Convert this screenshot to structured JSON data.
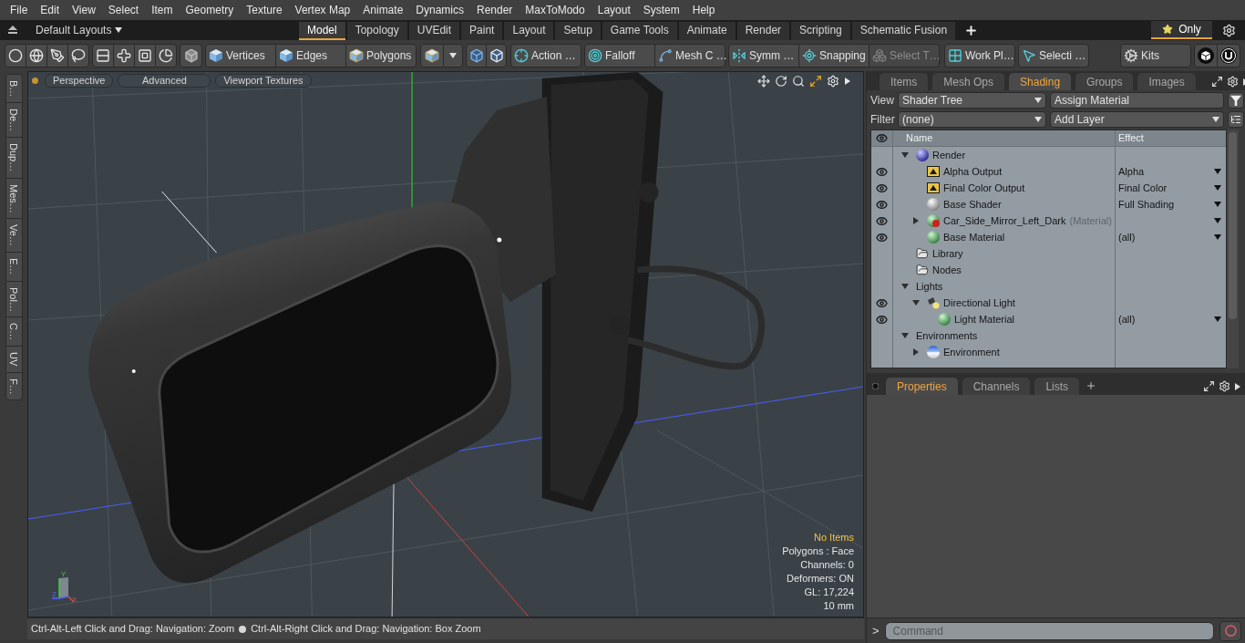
{
  "menu_bar": [
    "File",
    "Edit",
    "View",
    "Select",
    "Item",
    "Geometry",
    "Texture",
    "Vertex Map",
    "Animate",
    "Dynamics",
    "Render",
    "MaxToModo",
    "Layout",
    "System",
    "Help"
  ],
  "layout_bar": {
    "layouts": "Default Layouts",
    "tabs": [
      {
        "label": "Model",
        "selected": true
      },
      {
        "label": "Topology",
        "selected": false
      },
      {
        "label": "UVEdit",
        "selected": false
      },
      {
        "label": "Paint",
        "selected": false
      },
      {
        "label": "Layout",
        "selected": false
      },
      {
        "label": "Setup",
        "selected": false
      },
      {
        "label": "Game Tools",
        "selected": false
      },
      {
        "label": "Animate",
        "selected": false
      },
      {
        "label": "Render",
        "selected": false
      },
      {
        "label": "Scripting",
        "selected": false
      },
      {
        "label": "Schematic Fusion",
        "selected": false
      }
    ],
    "favorites": {
      "label": "Only",
      "selected": true
    }
  },
  "toolbar": {
    "buttons": [
      {
        "label": "Vertices",
        "disabled": false
      },
      {
        "label": "Edges",
        "disabled": false
      },
      {
        "label": "Polygons",
        "disabled": false
      },
      {
        "label": "Action …",
        "disabled": false
      },
      {
        "label": "Falloff",
        "disabled": false
      },
      {
        "label": "Mesh C …",
        "disabled": false
      },
      {
        "label": "Symm …",
        "disabled": false
      },
      {
        "label": "Snapping",
        "disabled": false
      },
      {
        "label": "Select T…",
        "disabled": true
      },
      {
        "label": "Work Pl…",
        "disabled": false
      },
      {
        "label": "Selecti …",
        "disabled": false
      },
      {
        "label": "Kits",
        "disabled": false
      }
    ]
  },
  "side_tabs": [
    "B…",
    "De…",
    "Dup…",
    "Mes…",
    "Ve…",
    "E…",
    "Pol…",
    "C…",
    "UV",
    "F…"
  ],
  "viewport": {
    "buttons": [
      "Perspective",
      "Advanced",
      "Viewport Textures"
    ],
    "axis_labels": [
      "Y",
      "Z",
      "X"
    ],
    "info": [
      {
        "kind": "title",
        "text": "No Items"
      },
      {
        "kind": "stat",
        "text": "Polygons : Face"
      },
      {
        "kind": "stat",
        "text": "Channels: 0"
      },
      {
        "kind": "stat",
        "text": "Deformers: ON"
      },
      {
        "kind": "stat",
        "text": "GL: 17,224"
      },
      {
        "kind": "stat",
        "text": "10 mm"
      }
    ]
  },
  "status_bar": {
    "hints": [
      "Ctrl-Alt-Left Click and Drag: Navigation: Zoom",
      "Ctrl-Alt-Right Click and Drag: Navigation: Box Zoom"
    ]
  },
  "shading_panel": {
    "tabs": [
      {
        "label": "Items",
        "selected": false
      },
      {
        "label": "Mesh Ops",
        "selected": false
      },
      {
        "label": "Shading",
        "selected": true
      },
      {
        "label": "Groups",
        "selected": false
      },
      {
        "label": "Images",
        "selected": false
      }
    ],
    "view": {
      "label": "View",
      "value": "Shader Tree"
    },
    "assign_button": "Assign Material",
    "filter": {
      "label": "Filter",
      "value": "(none)"
    },
    "add_layer": "Add Layer",
    "columns": [
      "Name",
      "Effect"
    ],
    "tree": [
      {
        "name": "Render",
        "kind": "render",
        "visible": false,
        "effect_menu": false,
        "expanded": true,
        "children": [
          {
            "name": "Alpha Output",
            "kind": "output",
            "visible": true,
            "effect_menu": true,
            "effect": "Alpha"
          },
          {
            "name": "Final Color Output",
            "kind": "output",
            "visible": true,
            "effect_menu": true,
            "effect": "Final Color"
          },
          {
            "name": "Base Shader",
            "kind": "shader",
            "visible": true,
            "effect_menu": true,
            "effect": "Full Shading"
          },
          {
            "name": "Car_Side_Mirror_Left_Dark",
            "tag": "(Material)",
            "kind": "mask",
            "visible": true,
            "effect_menu": true,
            "expanded": false
          },
          {
            "name": "Base Material",
            "kind": "material",
            "visible": true,
            "effect_menu": true,
            "effect": "(all)"
          }
        ]
      },
      {
        "name": "Library",
        "kind": "folder",
        "visible": false,
        "effect_menu": false
      },
      {
        "name": "Nodes",
        "kind": "folder",
        "visible": false,
        "effect_menu": false
      },
      {
        "name": "Lights",
        "kind": "group",
        "visible": false,
        "effect_menu": false,
        "expanded": true,
        "children": [
          {
            "name": "Directional Light",
            "kind": "light",
            "visible": true,
            "effect_menu": false,
            "expanded": true,
            "children": [
              {
                "name": "Light Material",
                "kind": "material",
                "visible": true,
                "effect_menu": true,
                "effect": "(all)"
              }
            ]
          }
        ]
      },
      {
        "name": "Environments",
        "kind": "group",
        "visible": false,
        "effect_menu": false,
        "expanded": true,
        "children": [
          {
            "name": "Environment",
            "kind": "environment",
            "visible": false,
            "effect_menu": false,
            "expanded": false
          }
        ]
      }
    ]
  },
  "properties_panel": {
    "tabs": [
      {
        "label": "Properties",
        "selected": true
      },
      {
        "label": "Channels",
        "selected": false
      },
      {
        "label": "Lists",
        "selected": false
      }
    ]
  },
  "command_bar": {
    "prompt": ">",
    "placeholder": "Command"
  }
}
